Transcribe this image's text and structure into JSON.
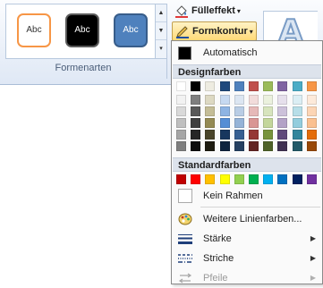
{
  "ribbon": {
    "gallery_items": [
      {
        "label": "Abc"
      },
      {
        "label": "Abc"
      },
      {
        "label": "Abc"
      }
    ],
    "group_label": "Formenarten",
    "fill_button": "Fülleffekt",
    "outline_button": "Formkontur",
    "wordart_glyph": "A"
  },
  "menu": {
    "automatic": "Automatisch",
    "theme_colors_header": "Designfarben",
    "theme_colors": [
      [
        "#ffffff",
        "#f2f2f2",
        "#d9d9d9",
        "#bfbfbf",
        "#a6a6a6",
        "#7f7f7f"
      ],
      [
        "#000000",
        "#7f7f7f",
        "#595959",
        "#404040",
        "#262626",
        "#0d0d0d"
      ],
      [
        "#eeece1",
        "#ddd9c3",
        "#c4bd97",
        "#948a54",
        "#4a452a",
        "#1d1b10"
      ],
      [
        "#1f497d",
        "#c6d9f1",
        "#8eb4e3",
        "#558ed5",
        "#17375e",
        "#0f243e"
      ],
      [
        "#4f81bd",
        "#dce6f2",
        "#b9cde5",
        "#95b3d7",
        "#376092",
        "#254061"
      ],
      [
        "#c0504d",
        "#f2dcdb",
        "#e6b9b8",
        "#d99694",
        "#953735",
        "#632523"
      ],
      [
        "#9bbb59",
        "#ebf1de",
        "#d7e4bd",
        "#c3d69b",
        "#77933c",
        "#4f6228"
      ],
      [
        "#8064a2",
        "#e6e0ec",
        "#ccc1da",
        "#b3a2c7",
        "#604a7b",
        "#403152"
      ],
      [
        "#4bacc6",
        "#dbeef4",
        "#b7dee8",
        "#93cddd",
        "#31859c",
        "#215968"
      ],
      [
        "#f79646",
        "#fdeada",
        "#fcd5b5",
        "#fac090",
        "#e46c0a",
        "#984807"
      ]
    ],
    "standard_colors_header": "Standardfarben",
    "standard_colors": [
      "#c00000",
      "#ff0000",
      "#ffc000",
      "#ffff00",
      "#92d050",
      "#00b050",
      "#00b0f0",
      "#0070c0",
      "#002060",
      "#7030a0"
    ],
    "no_outline": "Kein Rahmen",
    "more_colors": "Weitere Linienfarben...",
    "weight": "Stärke",
    "dashes": "Striche",
    "arrows": "Pfeile"
  }
}
